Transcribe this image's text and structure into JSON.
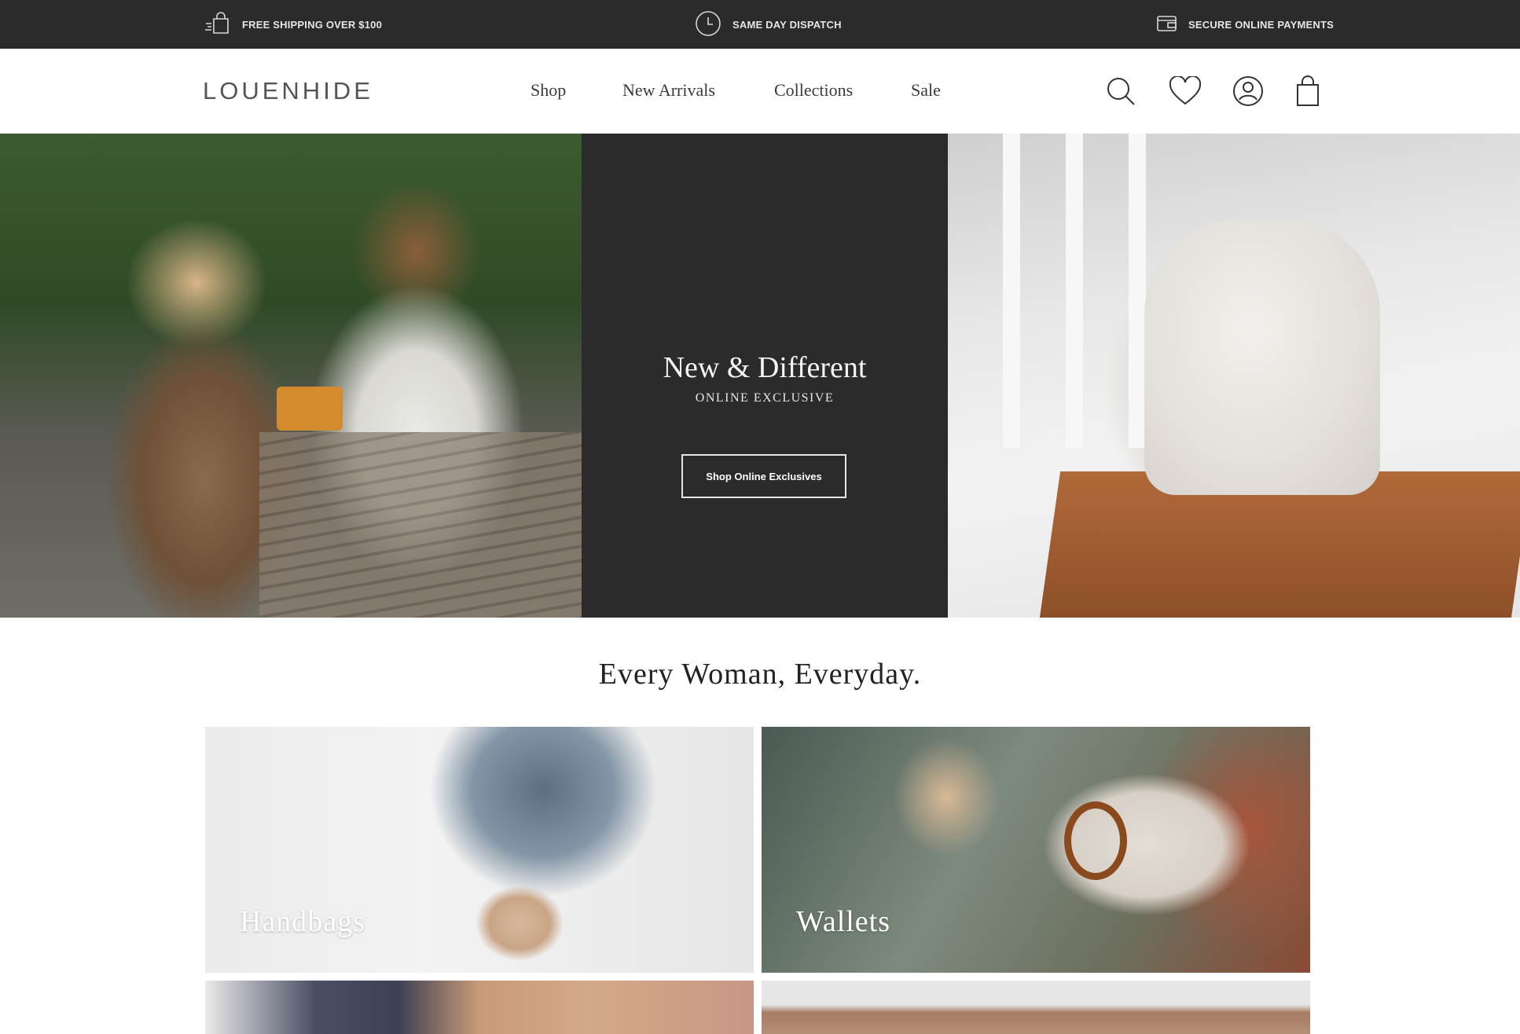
{
  "announcements": {
    "shipping": "FREE SHIPPING OVER $100",
    "dispatch": "SAME DAY DISPATCH",
    "payments": "SECURE ONLINE PAYMENTS"
  },
  "header": {
    "logo": "LOUENHIDE",
    "nav": [
      "Shop",
      "New Arrivals",
      "Collections",
      "Sale"
    ],
    "icons": [
      "search-icon",
      "heart-icon",
      "account-icon",
      "shopping-bag-icon"
    ]
  },
  "hero": {
    "title": "New & Different",
    "subtitle": "ONLINE EXCLUSIVE",
    "button": "Shop Online Exclusives"
  },
  "tagline": "Every Woman, Everyday.",
  "categories": [
    {
      "label": "Handbags"
    },
    {
      "label": "Wallets"
    },
    {
      "label": ""
    },
    {
      "label": ""
    }
  ],
  "colors": {
    "topbar": "#2b2b2b",
    "hero_panel": "#2b2b2b",
    "text": "#222222"
  }
}
